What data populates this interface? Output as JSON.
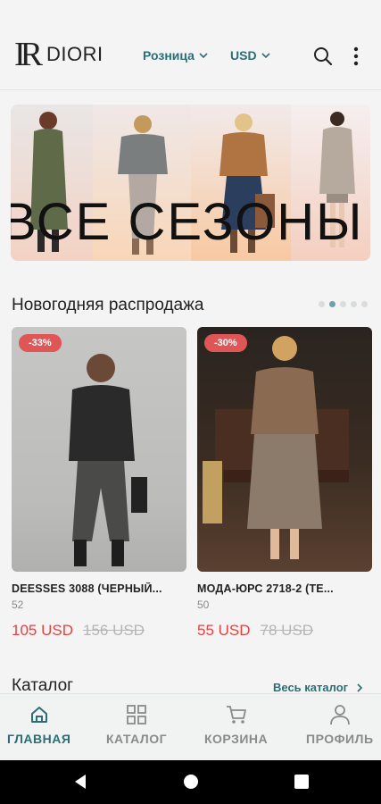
{
  "header": {
    "logo_text": "DIORI",
    "logo_mark": "IR",
    "price_type": "Розница",
    "currency": "USD"
  },
  "banner": {
    "caption": "ВСЕ СЕЗОНЫ"
  },
  "sale_section": {
    "title": "Новогодняя распродажа",
    "page_count": 5,
    "active_page": 2
  },
  "products": [
    {
      "badge": "-33%",
      "name": "DEESSES 3088 (ЧЕРНЫЙ...",
      "code": "52",
      "price": "105 USD",
      "old_price": "156 USD"
    },
    {
      "badge": "-30%",
      "name": "МОДА-ЮРС 2718-2 (ТЕ...",
      "code": "50",
      "price": "55 USD",
      "old_price": "78 USD"
    }
  ],
  "catalog": {
    "title": "Каталог",
    "link": "Весь каталог"
  },
  "nav": {
    "home": "ГЛАВНАЯ",
    "catalog": "КАТАЛОГ",
    "cart": "КОРЗИНА",
    "profile": "ПРОФИЛЬ"
  },
  "colors": {
    "accent": "#2b6e76",
    "sale": "#e24444",
    "badge": "#e05656"
  }
}
